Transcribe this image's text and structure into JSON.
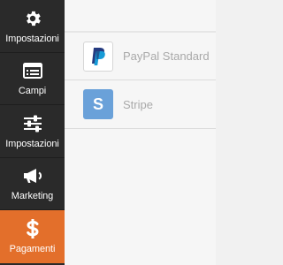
{
  "sidebar": {
    "items": [
      {
        "label": "Impostazioni",
        "icon": "gear-icon"
      },
      {
        "label": "Campi",
        "icon": "list-icon"
      },
      {
        "label": "Impostazioni",
        "icon": "sliders-icon"
      },
      {
        "label": "Marketing",
        "icon": "megaphone-icon"
      },
      {
        "label": "Pagamenti",
        "icon": "dollar-icon",
        "active": true
      }
    ],
    "active_color": "#e36f2b",
    "background_color": "#2a2a2a"
  },
  "payments": {
    "items": [
      {
        "name": "PayPal Standard",
        "logo": "paypal-logo"
      },
      {
        "name": "Stripe",
        "logo": "stripe-logo",
        "logo_text": "S"
      }
    ]
  }
}
